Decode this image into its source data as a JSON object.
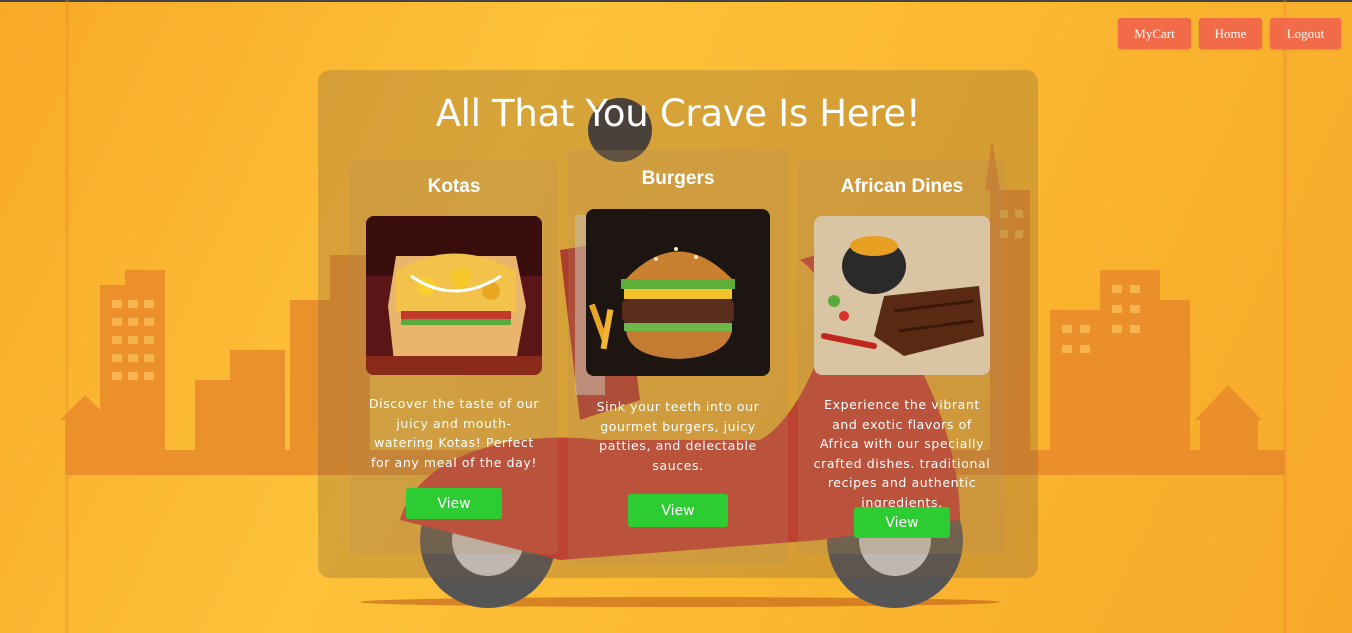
{
  "nav": {
    "cart_label": "MyCart",
    "home_label": "Home",
    "logout_label": "Logout"
  },
  "hero": {
    "headline": "All That You Crave Is Here!"
  },
  "cards": [
    {
      "title": "Kotas",
      "description": "Discover the taste of our juicy and mouth-watering Kotas! Perfect for any meal of the day!",
      "button_label": "View",
      "image_icon": "kota-sandwich-photo"
    },
    {
      "title": "Burgers",
      "description": "Sink your teeth into our gourmet burgers, juicy patties, and delectable sauces.",
      "button_label": "View",
      "image_icon": "burger-photo"
    },
    {
      "title": "African Dines",
      "description": "Experience the vibrant and exotic flavors of Africa with our specially crafted dishes. traditional recipes and authentic ingredients.",
      "button_label": "View",
      "image_icon": "african-dish-photo"
    }
  ],
  "colors": {
    "background": "#fdc23a",
    "nav_button": "#f26b48",
    "view_button": "#2ecc33",
    "city": "#e8892a"
  }
}
